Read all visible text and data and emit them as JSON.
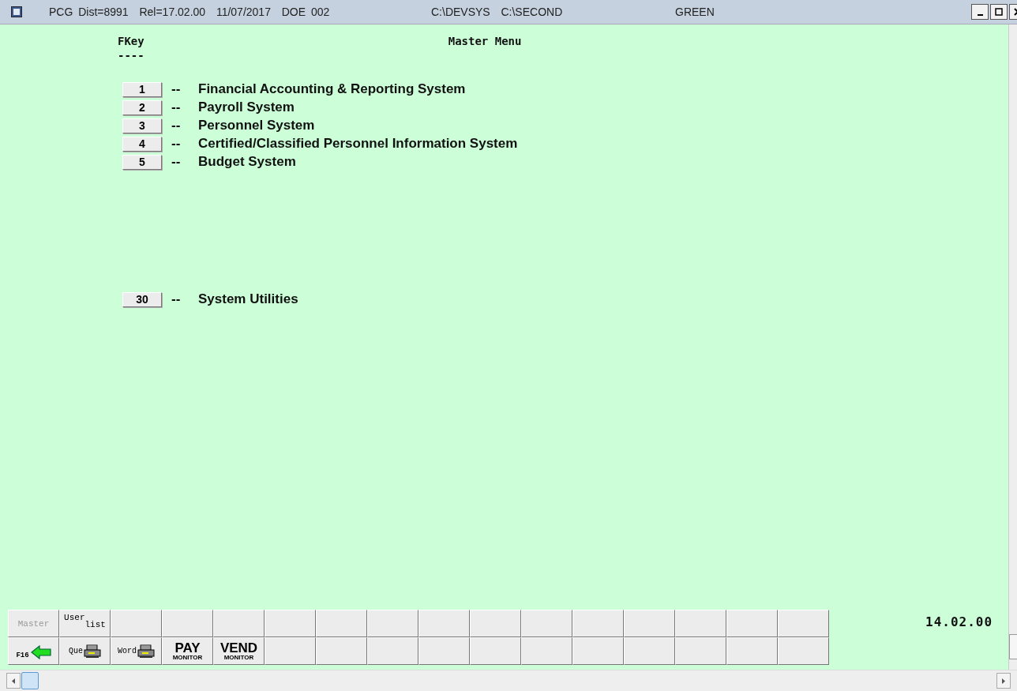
{
  "window": {
    "title_segments": [
      "PCG Dist=8991  Rel=17.02.00  11/07/2017  DOE 002",
      "C:\\DEVSYS  C:\\SECOND",
      "GREEN"
    ]
  },
  "header": {
    "key_column": "FKey",
    "underline": "----",
    "title": "Master Menu"
  },
  "menu_items": [
    {
      "key": "1",
      "separator": "--",
      "label": "Financial Accounting & Reporting System"
    },
    {
      "key": "2",
      "separator": "--",
      "label": "Payroll System"
    },
    {
      "key": "3",
      "separator": "--",
      "label": "Personnel System"
    },
    {
      "key": "4",
      "separator": "--",
      "label": "Certified/Classified Personnel Information System"
    },
    {
      "key": "5",
      "separator": "--",
      "label": "Budget System"
    }
  ],
  "utility_items": [
    {
      "key": "30",
      "separator": "--",
      "label": "System Utilities"
    }
  ],
  "toolbar": {
    "rows": [
      [
        {
          "kind": "label",
          "text": "Master",
          "disabled": true
        },
        {
          "kind": "stacked",
          "top": "User",
          "bottom": "list"
        },
        {
          "kind": "empty"
        },
        {
          "kind": "empty"
        },
        {
          "kind": "empty"
        },
        {
          "kind": "empty"
        },
        {
          "kind": "empty"
        },
        {
          "kind": "empty"
        },
        {
          "kind": "empty"
        },
        {
          "kind": "empty"
        },
        {
          "kind": "empty"
        },
        {
          "kind": "empty"
        },
        {
          "kind": "empty"
        },
        {
          "kind": "empty"
        },
        {
          "kind": "empty"
        },
        {
          "kind": "empty"
        }
      ],
      [
        {
          "kind": "back",
          "text": "F16"
        },
        {
          "kind": "printer",
          "text": "Que"
        },
        {
          "kind": "printer",
          "text": "Word"
        },
        {
          "kind": "monitor",
          "top": "PAY",
          "bottom": "MONITOR"
        },
        {
          "kind": "monitor",
          "top": "VEND",
          "bottom": "MONITOR"
        },
        {
          "kind": "empty"
        },
        {
          "kind": "empty"
        },
        {
          "kind": "empty"
        },
        {
          "kind": "empty"
        },
        {
          "kind": "empty"
        },
        {
          "kind": "empty"
        },
        {
          "kind": "empty"
        },
        {
          "kind": "empty"
        },
        {
          "kind": "empty"
        },
        {
          "kind": "empty"
        },
        {
          "kind": "empty"
        }
      ]
    ],
    "time": "14.02.00"
  }
}
